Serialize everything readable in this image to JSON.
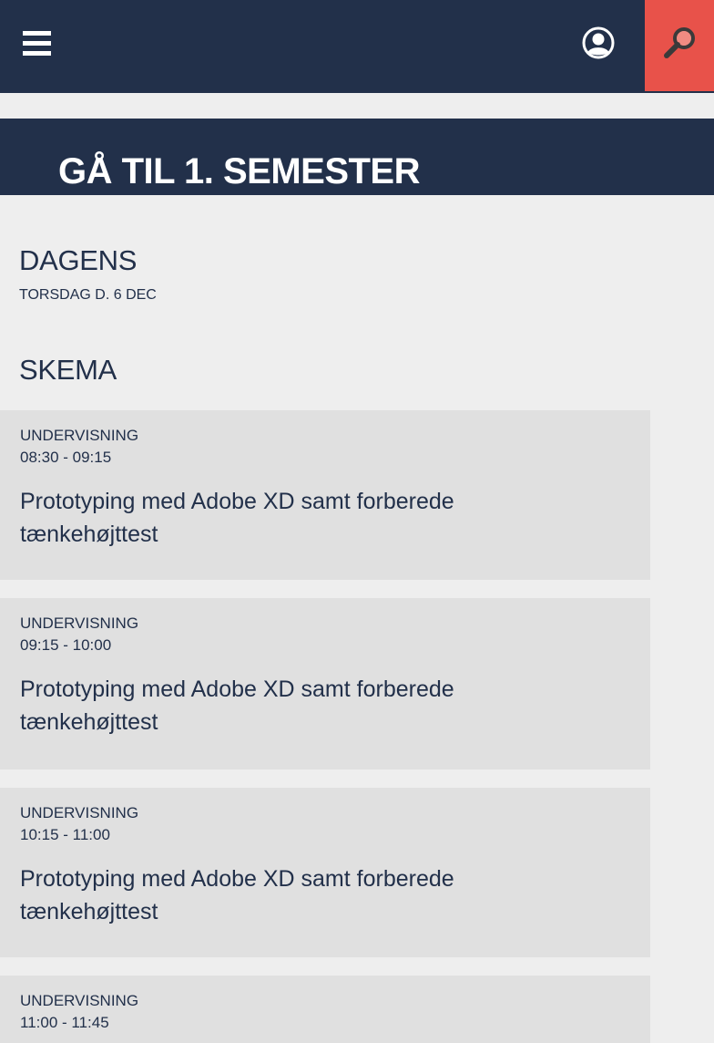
{
  "header": {
    "menu_icon": "hamburger-menu-icon",
    "profile_icon": "user-circle-icon",
    "search_icon": "magnifier-icon",
    "colors": {
      "bar": "#22304a",
      "search": "#e8524a"
    }
  },
  "semester_link": {
    "label": "GÅ TIL 1. SEMESTER"
  },
  "today": {
    "heading": "DAGENS",
    "date": "TORSDAG D. 6 DEC"
  },
  "schedule": {
    "heading": "SKEMA",
    "items": [
      {
        "type": "UNDERVISNING",
        "time": "08:30 - 09:15",
        "title": "Prototyping med Adobe XD samt forberede tænkehøjttest"
      },
      {
        "type": "UNDERVISNING",
        "time": "09:15 - 10:00",
        "title": "Prototyping med Adobe XD samt forberede tænkehøjttest"
      },
      {
        "type": "UNDERVISNING",
        "time": "10:15 - 11:00",
        "title": "Prototyping med Adobe XD samt forberede tænkehøjttest"
      },
      {
        "type": "UNDERVISNING",
        "time": "11:00 - 11:45",
        "title": ""
      }
    ]
  }
}
